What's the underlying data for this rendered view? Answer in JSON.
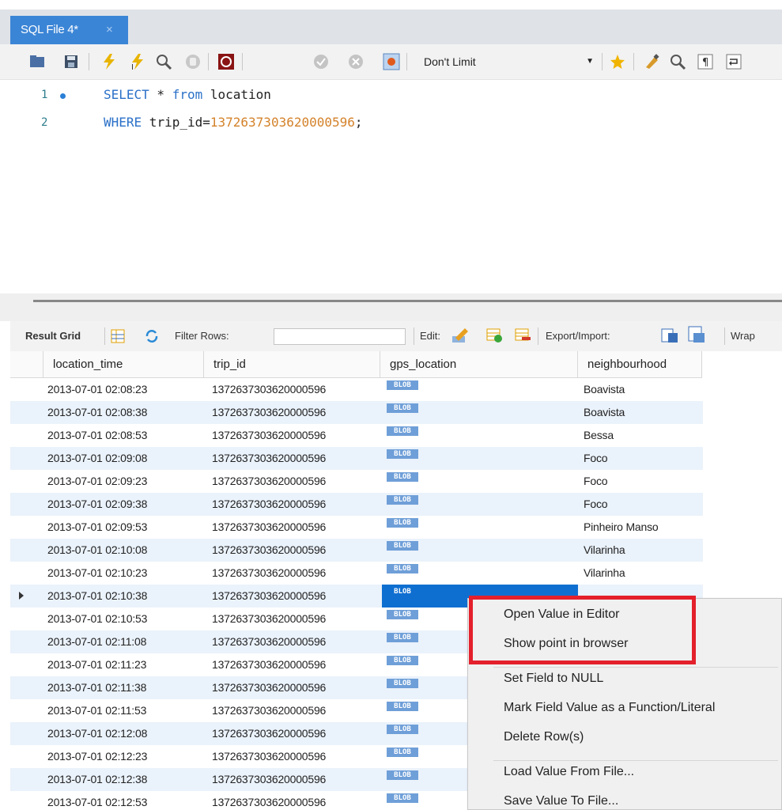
{
  "tab": {
    "title": "SQL File 4*",
    "close": "×"
  },
  "toolbar": {
    "limit_value": "Don't Limit",
    "icons": [
      "open-folder-icon",
      "save-icon",
      "execute-icon",
      "execute-selection-icon",
      "explain-icon",
      "stop-icon",
      "toggle-error-icon",
      "commit-icon",
      "rollback-icon",
      "autocommit-icon",
      "bookmark-icon",
      "beautify-icon",
      "find-icon",
      "invisible-chars-icon",
      "wrap-icon"
    ]
  },
  "editor": {
    "lines": [
      {
        "number": "1",
        "kw1": "SELECT",
        "text1": " * ",
        "kw2": "from",
        "text2": " location"
      },
      {
        "number": "2",
        "kw1": "WHERE",
        "text1": " trip_id=",
        "num": "1372637303620000596",
        "text2": ";"
      }
    ]
  },
  "resultbar": {
    "result_grid": "Result Grid",
    "filter_rows": "Filter Rows:",
    "edit": "Edit:",
    "export_import": "Export/Import:",
    "wrap": "Wrap"
  },
  "grid": {
    "columns": [
      "location_time",
      "trip_id",
      "gps_location",
      "neighbourhood"
    ],
    "blob_label": "BLOB",
    "rows": [
      {
        "time": "2013-07-01 02:08:23",
        "trip": "1372637303620000596",
        "hood": "Boavista"
      },
      {
        "time": "2013-07-01 02:08:38",
        "trip": "1372637303620000596",
        "hood": "Boavista"
      },
      {
        "time": "2013-07-01 02:08:53",
        "trip": "1372637303620000596",
        "hood": "Bessa"
      },
      {
        "time": "2013-07-01 02:09:08",
        "trip": "1372637303620000596",
        "hood": "Foco"
      },
      {
        "time": "2013-07-01 02:09:23",
        "trip": "1372637303620000596",
        "hood": "Foco"
      },
      {
        "time": "2013-07-01 02:09:38",
        "trip": "1372637303620000596",
        "hood": "Foco"
      },
      {
        "time": "2013-07-01 02:09:53",
        "trip": "1372637303620000596",
        "hood": "Pinheiro Manso"
      },
      {
        "time": "2013-07-01 02:10:08",
        "trip": "1372637303620000596",
        "hood": "Vilarinha"
      },
      {
        "time": "2013-07-01 02:10:23",
        "trip": "1372637303620000596",
        "hood": "Vilarinha"
      },
      {
        "time": "2013-07-01 02:10:38",
        "trip": "1372637303620000596",
        "hood": ""
      },
      {
        "time": "2013-07-01 02:10:53",
        "trip": "1372637303620000596",
        "hood": ""
      },
      {
        "time": "2013-07-01 02:11:08",
        "trip": "1372637303620000596",
        "hood": ""
      },
      {
        "time": "2013-07-01 02:11:23",
        "trip": "1372637303620000596",
        "hood": ""
      },
      {
        "time": "2013-07-01 02:11:38",
        "trip": "1372637303620000596",
        "hood": ""
      },
      {
        "time": "2013-07-01 02:11:53",
        "trip": "1372637303620000596",
        "hood": ""
      },
      {
        "time": "2013-07-01 02:12:08",
        "trip": "1372637303620000596",
        "hood": ""
      },
      {
        "time": "2013-07-01 02:12:23",
        "trip": "1372637303620000596",
        "hood": ""
      },
      {
        "time": "2013-07-01 02:12:38",
        "trip": "1372637303620000596",
        "hood": ""
      },
      {
        "time": "2013-07-01 02:12:53",
        "trip": "1372637303620000596",
        "hood": ""
      }
    ]
  },
  "context_menu": {
    "items": [
      "Open Value in Editor",
      "Show point in browser",
      "Set Field to NULL",
      "Mark Field Value as a Function/Literal",
      "Delete Row(s)",
      "Load Value From File...",
      "Save Value To File..."
    ]
  },
  "colors": {
    "tab_blue": "#3b85d6",
    "selection": "#0f6fd1",
    "highlight_red": "#e3202c",
    "row_alt": "#eaf2fb"
  }
}
